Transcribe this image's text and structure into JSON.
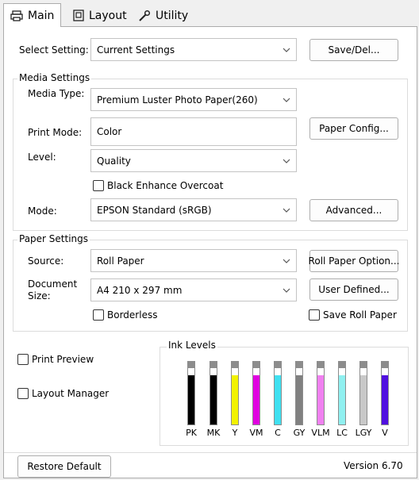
{
  "tabs": [
    {
      "label": "Main",
      "icon": "printer-icon"
    },
    {
      "label": "Layout",
      "icon": "layout-icon"
    },
    {
      "label": "Utility",
      "icon": "wrench-icon"
    }
  ],
  "select_setting": {
    "label": "Select Setting:",
    "value": "Current Settings",
    "button": "Save/Del..."
  },
  "media_settings": {
    "title": "Media Settings",
    "media_type": {
      "label": "Media Type:",
      "value": "Premium Luster Photo Paper(260)"
    },
    "print_mode": {
      "label": "Print Mode:",
      "value": "Color",
      "button": "Paper Config..."
    },
    "level": {
      "label": "Level:",
      "value": "Quality"
    },
    "black_enhance": {
      "label": "Black Enhance Overcoat",
      "checked": false
    },
    "mode": {
      "label": "Mode:",
      "value": "EPSON Standard (sRGB)",
      "button": "Advanced..."
    }
  },
  "paper_settings": {
    "title": "Paper Settings",
    "source": {
      "label": "Source:",
      "value": "Roll Paper",
      "button": "Roll Paper Option..."
    },
    "document_size": {
      "label_line1": "Document",
      "label_line2": "Size:",
      "value": "A4 210 x 297 mm",
      "button": "User Defined..."
    },
    "borderless": {
      "label": "Borderless",
      "checked": false
    },
    "save_roll_paper": {
      "label": "Save Roll Paper",
      "checked": false
    }
  },
  "print_preview": {
    "label": "Print Preview",
    "checked": false
  },
  "layout_manager": {
    "label": "Layout Manager",
    "checked": false
  },
  "ink_levels": {
    "title": "Ink Levels",
    "inks": [
      {
        "name": "PK",
        "color": "#000000",
        "level": 0.88
      },
      {
        "name": "MK",
        "color": "#000000",
        "level": 0.88
      },
      {
        "name": "Y",
        "color": "#f2f200",
        "level": 0.88
      },
      {
        "name": "VM",
        "color": "#e000e0",
        "level": 0.88
      },
      {
        "name": "C",
        "color": "#40e0f0",
        "level": 0.88
      },
      {
        "name": "GY",
        "color": "#808080",
        "level": 0.88
      },
      {
        "name": "VLM",
        "color": "#f080f0",
        "level": 0.88
      },
      {
        "name": "LC",
        "color": "#90f0f0",
        "level": 0.88
      },
      {
        "name": "LGY",
        "color": "#c8c8c8",
        "level": 0.88
      },
      {
        "name": "V",
        "color": "#5010e0",
        "level": 0.88
      }
    ]
  },
  "footer": {
    "restore_default": "Restore Default",
    "version": "Version 6.70"
  }
}
